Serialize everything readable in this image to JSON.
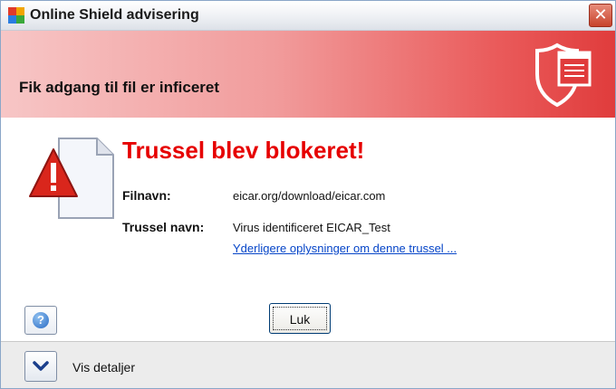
{
  "window": {
    "title": "Online Shield advisering",
    "close_symbol": "✕"
  },
  "banner": {
    "title": "Fik adgang til fil er inficeret",
    "icon": "shield-window-icon"
  },
  "alert": {
    "headline": "Trussel blev blokeret!",
    "icon": "warning-document-icon",
    "file_label": "Filnavn:",
    "file_value": "eicar.org/download/eicar.com",
    "threat_label": "Trussel navn:",
    "threat_value": "Virus identificeret EICAR_Test",
    "more_info_link": "Yderligere oplysninger om denne trussel ..."
  },
  "buttons": {
    "help_symbol": "?",
    "close_label": "Luk"
  },
  "footer": {
    "details_label": "Vis detaljer",
    "details_icon": "chevron-down-icon"
  },
  "colors": {
    "headline_red": "#e60000",
    "banner_red": "#e03c3c",
    "link_blue": "#0645c8"
  }
}
